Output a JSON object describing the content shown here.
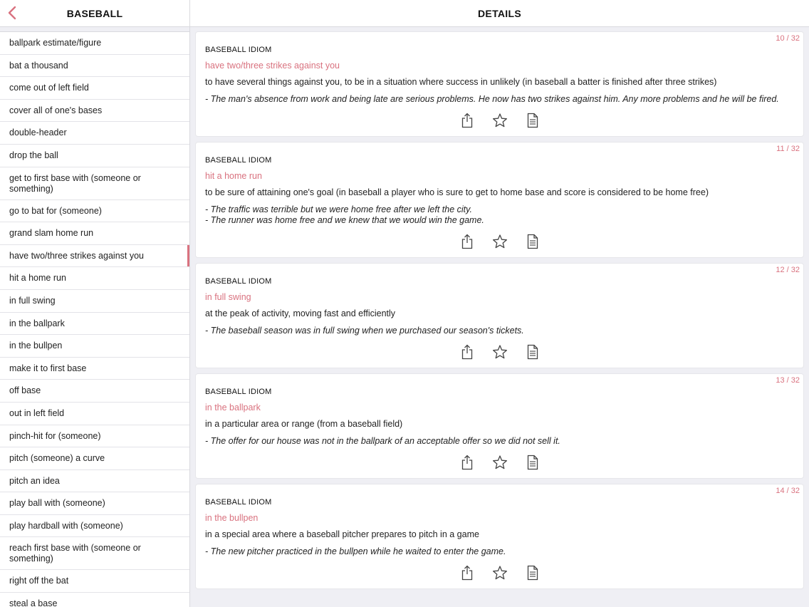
{
  "sidebar": {
    "title": "BASEBALL",
    "items": [
      "ballpark estimate/figure",
      "bat a thousand",
      "come out of left field",
      "cover all of one's bases",
      "double-header",
      "drop the ball",
      "get to first base with (someone or something)",
      "go to bat for (someone)",
      "grand slam home run",
      "have two/three strikes against you",
      "hit a home run",
      "in full swing",
      "in the ballpark",
      "in the bullpen",
      "make it to first base",
      "off base",
      "out in left field",
      "pinch-hit for (someone)",
      "pitch (someone) a curve",
      "pitch an idea",
      "play ball with (someone)",
      "play hardball with (someone)",
      "reach first base with (someone or something)",
      "right off the bat",
      "steal a base"
    ],
    "active_index": 9
  },
  "main": {
    "title": "DETAILS",
    "cards": [
      {
        "counter": "10 / 32",
        "category": "BASEBALL IDIOM",
        "idiom": "have two/three strikes against you",
        "definition": "to have several things against you, to be in a situation where success in unlikely (in baseball a batter is finished after three strikes)",
        "examples": [
          "- The man's absence from work and being late are serious problems. He now has two strikes against him. Any more problems and he will be fired."
        ]
      },
      {
        "counter": "11 / 32",
        "category": "BASEBALL IDIOM",
        "idiom": "hit a home run",
        "definition": "to be sure of attaining one's goal (in baseball a player who is sure to get to home base and score is considered to be home free)",
        "examples": [
          "- The traffic was terrible but we were home free after we left the city.",
          "- The runner was home free and we knew that we would win the game."
        ]
      },
      {
        "counter": "12 / 32",
        "category": "BASEBALL IDIOM",
        "idiom": "in full swing",
        "definition": "at the peak of activity, moving fast and efficiently",
        "examples": [
          "- The baseball season was in full swing when we purchased our season's tickets."
        ]
      },
      {
        "counter": "13 / 32",
        "category": "BASEBALL IDIOM",
        "idiom": "in the ballpark",
        "definition": "in a particular area or range (from a baseball field)",
        "examples": [
          "- The offer for our house was not in the ballpark of an acceptable offer so we did not sell it."
        ]
      },
      {
        "counter": "14 / 32",
        "category": "BASEBALL IDIOM",
        "idiom": "in the bullpen",
        "definition": "in a special area where a baseball pitcher prepares to pitch in a game",
        "examples": [
          "- The new pitcher practiced in the bullpen while he waited to enter the game."
        ]
      }
    ]
  },
  "icons": {
    "back": "chevron-left-icon",
    "share": "share-icon",
    "favorite": "star-icon",
    "notes": "document-icon"
  },
  "colors": {
    "accent": "#d9727f",
    "background": "#efeff4"
  }
}
